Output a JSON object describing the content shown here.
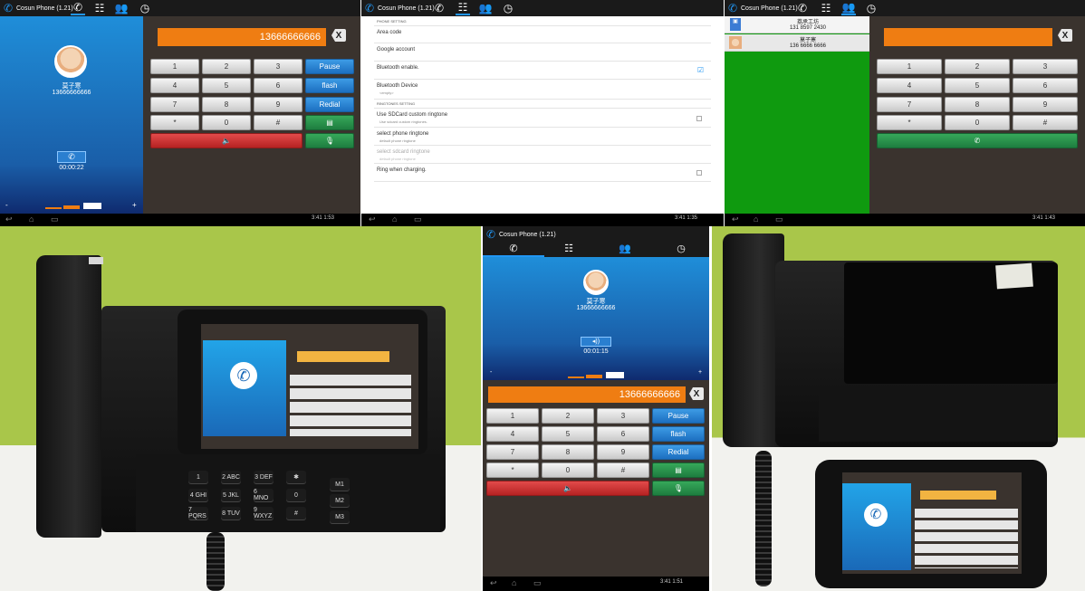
{
  "app": {
    "title": "Cosun Phone (1.21)"
  },
  "call_screen": {
    "caller_name": "莫子寒",
    "caller_number": "13666666666",
    "timer_panel1": "00:00:22",
    "timer_panel5": "00:01:15",
    "dialed_number": "13666666666",
    "volume_minus": "-",
    "volume_plus": "+"
  },
  "keypad": {
    "keys": [
      "1",
      "2",
      "3",
      "4",
      "5",
      "6",
      "7",
      "8",
      "9",
      "*",
      "0",
      "#"
    ],
    "pause_label": "Pause",
    "flash_label": "flash",
    "redial_label": "Redial",
    "clear_label": "X"
  },
  "settings": {
    "section_phone": "PHONE SETTING",
    "area_code": "Area code",
    "google_account": "Google account",
    "bluetooth_enable": "Bluetooth enable.",
    "bluetooth_device": "Bluetooth Device",
    "bluetooth_device_sub": "<empty>",
    "section_ringtones": "RINGTONES SETTING",
    "sdcard_ringtone": "Use SDCard custom ringtone",
    "sdcard_ringtone_sub": "Use sdcard custom ringtones.",
    "phone_ringtone": "select phone ringtone",
    "phone_ringtone_sub": "default phone ringtone",
    "sdcard_select": "select sdcard ringtone",
    "sdcard_select_sub": "default phone ringtone",
    "ring_charging": "Ring when charging."
  },
  "contacts": [
    {
      "name": "荔承工坊",
      "number": "131 8597 2430"
    },
    {
      "name": "莫子寒",
      "number": "136 6666 6666"
    }
  ],
  "status_bar": {
    "clock_1": "3:41 1:53",
    "clock_2": "3:41 1:35",
    "clock_3": "3:41 1:43",
    "clock_5": "3:41 1:51"
  },
  "hardware": {
    "keys": [
      "1",
      "2 ABC",
      "3 DEF",
      "✱",
      "4 GHI",
      "5 JKL",
      "6 MNO",
      "0",
      "7 PQRS",
      "8 TUV",
      "9 WXYZ",
      "#"
    ],
    "memory_keys": [
      "M1",
      "M2",
      "M3"
    ]
  },
  "colors": {
    "accent_orange": "#ef7d12",
    "accent_blue": "#2196f3",
    "green_bg": "#0f9a0f",
    "call_blue": "#1b6fc1"
  }
}
